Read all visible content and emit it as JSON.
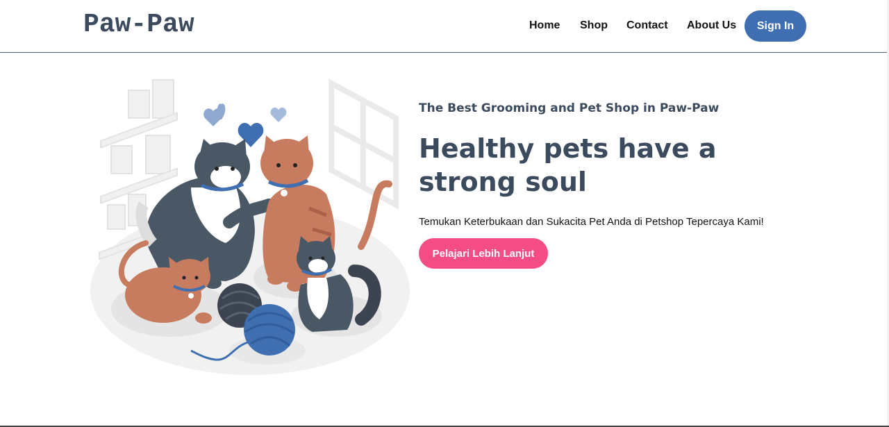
{
  "brand": {
    "logo_text": "Paw-Paw"
  },
  "nav": {
    "items": [
      {
        "label": "Home"
      },
      {
        "label": "Shop"
      },
      {
        "label": "Contact"
      },
      {
        "label": "About Us"
      }
    ],
    "signin_label": "Sign In"
  },
  "hero": {
    "tagline": "The Best Grooming and Pet Shop in Paw-Paw",
    "headline": "Healthy pets have a strong soul",
    "subtext": "Temukan Keterbukaan dan Sukacita Pet Anda di Petshop Tepercaya Kami!",
    "cta_label": "Pelajari Lebih Lanjut"
  },
  "colors": {
    "primary": "#3f6fb0",
    "heading": "#3b4a5c",
    "cta": "#f44d86",
    "cat_orange": "#c77b5f",
    "cat_gray": "#4a5866"
  },
  "icons": [
    "heart-icon",
    "yarn-ball-icon"
  ]
}
